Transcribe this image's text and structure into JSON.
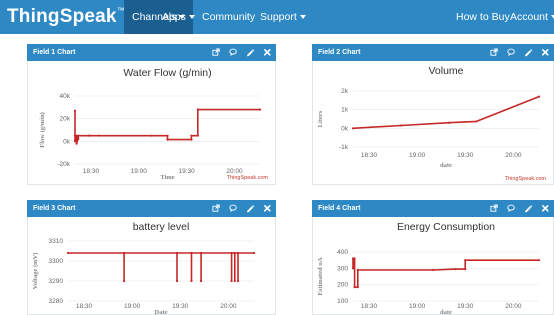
{
  "nav": {
    "brand": "ThingSpeak",
    "brand_tm": "™",
    "channels": "Channels",
    "apps": "Apps",
    "community": "Community",
    "support": "Support",
    "how_to_buy": "How to Buy",
    "account": "Account"
  },
  "colors": {
    "nav": "#2d88c4",
    "nav_active": "#1b5f90",
    "series": "#c62828"
  },
  "panels": [
    {
      "title": "Field 1 Chart"
    },
    {
      "title": "Field 2 Chart"
    },
    {
      "title": "Field 3 Chart"
    },
    {
      "title": "Field 4 Chart"
    }
  ],
  "icons": [
    "external-link-icon",
    "comment-icon",
    "pencil-icon",
    "close-icon"
  ],
  "chart_data": [
    {
      "type": "line",
      "title": "Water Flow (g/min)",
      "xlabel": "Time",
      "ylabel": "Flow (g/min)",
      "credit": "ThingSpeak.com",
      "x_ticks": [
        "18:30",
        "19:00",
        "19:30",
        "20:00"
      ],
      "y_ticks": [
        "40k",
        "20k",
        "0k",
        "-20k"
      ],
      "xlim": [
        "18:20",
        "20:16"
      ],
      "ylim": [
        -20000,
        40000
      ],
      "series": [
        {
          "values": [
            [
              "18:20",
              0
            ],
            [
              "18:20",
              27000
            ],
            [
              "18:20",
              5000
            ],
            [
              "18:21",
              5000
            ],
            [
              "18:21",
              -2000
            ],
            [
              "18:22",
              3000
            ],
            [
              "18:22",
              2000
            ],
            [
              "18:22",
              5000
            ],
            [
              "18:29",
              5000
            ],
            [
              "18:29",
              5000
            ],
            [
              "18:35",
              5000
            ],
            [
              "19:08",
              5000
            ],
            [
              "19:18",
              5000
            ],
            [
              "19:18",
              1500
            ],
            [
              "19:33",
              1500
            ],
            [
              "19:33",
              5000
            ],
            [
              "19:37",
              5000
            ],
            [
              "19:37",
              28000
            ],
            [
              "20:16",
              28000
            ]
          ]
        }
      ]
    },
    {
      "type": "line",
      "title": "Volume",
      "xlabel": "date",
      "ylabel": "Liters",
      "credit": "ThingSpeak.com",
      "x_ticks": [
        "18:30",
        "19:00",
        "19:30",
        "20:00"
      ],
      "y_ticks": [
        "2k",
        "1k",
        "0k",
        "-1k"
      ],
      "xlim": [
        "18:20",
        "20:16"
      ],
      "ylim": [
        -1000,
        2000
      ],
      "series": [
        {
          "values": [
            [
              "18:20",
              0
            ],
            [
              "18:50",
              150
            ],
            [
              "19:20",
              300
            ],
            [
              "19:37",
              370
            ],
            [
              "20:16",
              1700
            ]
          ]
        }
      ]
    },
    {
      "type": "line",
      "title": "battery level",
      "xlabel": "Date",
      "ylabel": "Voltage (mV)",
      "x_ticks": [
        "18:30",
        "19:00",
        "19:30",
        "20:00"
      ],
      "y_ticks": [
        "3310",
        "3300",
        "3290",
        "3280"
      ],
      "xlim": [
        "18:20",
        "20:16"
      ],
      "ylim": [
        3280,
        3310
      ],
      "series": [
        {
          "values": [
            [
              "18:20",
              3304
            ],
            [
              "18:55",
              3304
            ],
            [
              "18:55",
              3290
            ],
            [
              "18:55",
              3304
            ],
            [
              "19:28",
              3304
            ],
            [
              "19:28",
              3290
            ],
            [
              "19:28",
              3304
            ],
            [
              "19:37",
              3304
            ],
            [
              "19:37",
              3290
            ],
            [
              "19:37",
              3304
            ],
            [
              "19:43",
              3304
            ],
            [
              "19:43",
              3290
            ],
            [
              "19:43",
              3304
            ],
            [
              "20:02",
              3304
            ],
            [
              "20:02",
              3290
            ],
            [
              "20:02",
              3304
            ],
            [
              "20:04",
              3304
            ],
            [
              "20:04",
              3290
            ],
            [
              "20:04",
              3304
            ],
            [
              "20:06",
              3304
            ],
            [
              "20:06",
              3290
            ],
            [
              "20:06",
              3304
            ],
            [
              "20:16",
              3304
            ]
          ]
        }
      ]
    },
    {
      "type": "line",
      "title": "Energy Consumption",
      "xlabel": "date",
      "ylabel": "Estimated uA",
      "x_ticks": [
        "18:30",
        "19:00",
        "19:30",
        "20:00"
      ],
      "y_ticks": [
        "400",
        "300",
        "200",
        "100"
      ],
      "xlim": [
        "18:20",
        "20:16"
      ],
      "ylim": [
        100,
        400
      ],
      "series": [
        {
          "values": [
            [
              "18:20",
              300
            ],
            [
              "18:20",
              360
            ],
            [
              "18:21",
              360
            ],
            [
              "18:21",
              185
            ],
            [
              "18:23",
              185
            ],
            [
              "18:23",
              290
            ],
            [
              "19:10",
              290
            ],
            [
              "19:24",
              295
            ],
            [
              "19:30",
              295
            ],
            [
              "19:30",
              350
            ],
            [
              "20:16",
              350
            ]
          ]
        }
      ]
    }
  ]
}
